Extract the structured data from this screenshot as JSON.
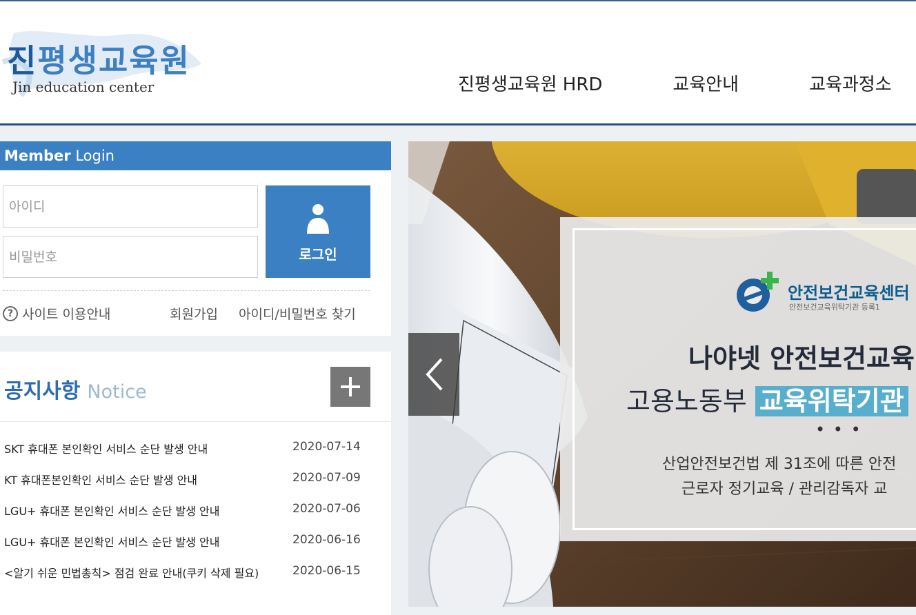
{
  "header": {
    "logo_title_first": "진",
    "logo_title_rest": "평생교육원",
    "logo_subtitle": "Jin education center",
    "nav": [
      "진평생교육원 HRD",
      "교육안내",
      "교육과정소"
    ]
  },
  "login": {
    "header_bold": "Member",
    "header_rest": "Login",
    "id_placeholder": "아이디",
    "pw_placeholder": "비밀번호",
    "button_label": "로그인",
    "help_link": "사이트 이용안내",
    "join_link": "회원가입",
    "find_link": "아이디/비밀번호 찾기"
  },
  "notice": {
    "title": "공지사항",
    "title_en": "Notice",
    "items": [
      {
        "title": "SKT 휴대폰 본인확인 서비스 순단 발생 안내",
        "date": "2020-07-14"
      },
      {
        "title": "KT 휴대폰본인확인 서비스 순단 발생 안내",
        "date": "2020-07-09"
      },
      {
        "title": "LGU+ 휴대폰 본인확인 서비스 순단 발생 안내",
        "date": "2020-07-06"
      },
      {
        "title": "LGU+ 휴대폰 본인확인 서비스 순단 발생 안내",
        "date": "2020-06-16"
      },
      {
        "title": "<알기 쉬운 민법총칙> 점검 완료 안내(쿠키 삭제 필요)",
        "date": "2020-06-15"
      }
    ]
  },
  "banner": {
    "org_name": "안전보건교육센터",
    "org_sub": "안전보건교육위탁기관 등록1",
    "headline": "나야넷 안전보건교육",
    "subline_prefix": "고용노동부",
    "subline_highlight": "교육위탁기관",
    "dots": "• • •",
    "desc1": "산업안전보건법 제 31조에 따른 안전",
    "desc2": "근로자 정기교육 / 관리감독자 교"
  },
  "colors": {
    "brand": "#3b80c2",
    "header_border": "#2a4f7c",
    "highlight": "#58aecd"
  }
}
